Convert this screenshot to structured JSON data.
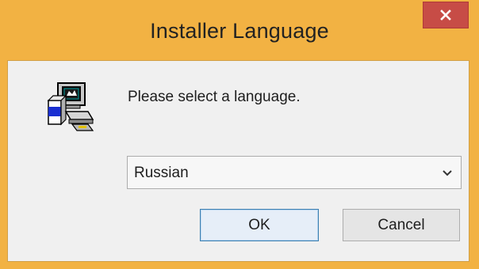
{
  "window": {
    "title": "Installer Language",
    "close_glyph": "✕",
    "close_icon": "close-icon",
    "app_icon": "installer-computer-icon"
  },
  "dialog": {
    "prompt": "Please select a language.",
    "language_select": {
      "selected": "Russian",
      "arrow_icon": "chevron-down-icon"
    },
    "ok_label": "OK",
    "cancel_label": "Cancel"
  },
  "colors": {
    "frame": "#f2b243",
    "close_button": "#c74c46",
    "client_background": "#f0f0f0",
    "default_button_border": "#3c7fb1"
  }
}
